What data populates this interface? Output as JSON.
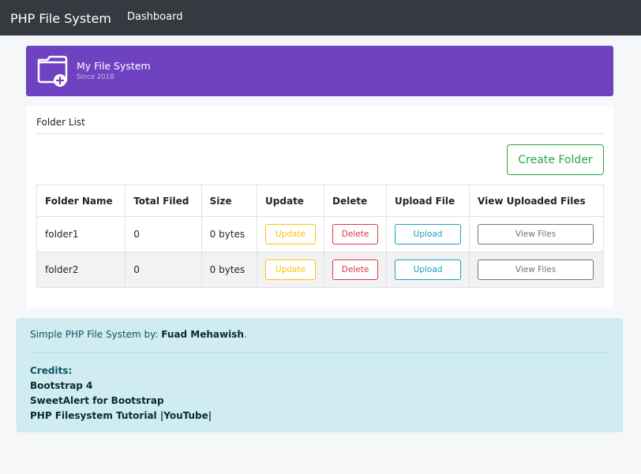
{
  "navbar": {
    "brand": "PHP File System",
    "links": [
      "Dashboard"
    ]
  },
  "banner": {
    "title": "My File System",
    "subtitle": "Since 2018",
    "icon": "folder-plus-icon",
    "color": "#6f42c1"
  },
  "folder_card": {
    "title": "Folder List",
    "create_button": "Create Folder",
    "columns": [
      "Folder Name",
      "Total Filed",
      "Size",
      "Update",
      "Delete",
      "Upload File",
      "View Uploaded Files"
    ],
    "rows": [
      {
        "name": "folder1",
        "total": "0",
        "size": "0 bytes",
        "update": "Update",
        "delete": "Delete",
        "upload": "Upload",
        "view": "View Files"
      },
      {
        "name": "folder2",
        "total": "0",
        "size": "0 bytes",
        "update": "Update",
        "delete": "Delete",
        "upload": "Upload",
        "view": "View Files"
      }
    ]
  },
  "footer": {
    "intro": "Simple PHP File System by: ",
    "author": "Fuad Mehawish",
    "period": ".",
    "credits_heading": "Credits:",
    "credits": [
      "Bootstrap 4",
      "SweetAlert for Bootstrap",
      "PHP Filesystem Tutorial |YouTube|"
    ]
  },
  "colors": {
    "navbar": "#343a40",
    "banner": "#6f42c1",
    "success": "#28a745",
    "warning": "#ffc107",
    "danger": "#dc3545",
    "info": "#17a2b8",
    "secondary": "#6c757d",
    "alert_bg": "#d1ecf1"
  }
}
